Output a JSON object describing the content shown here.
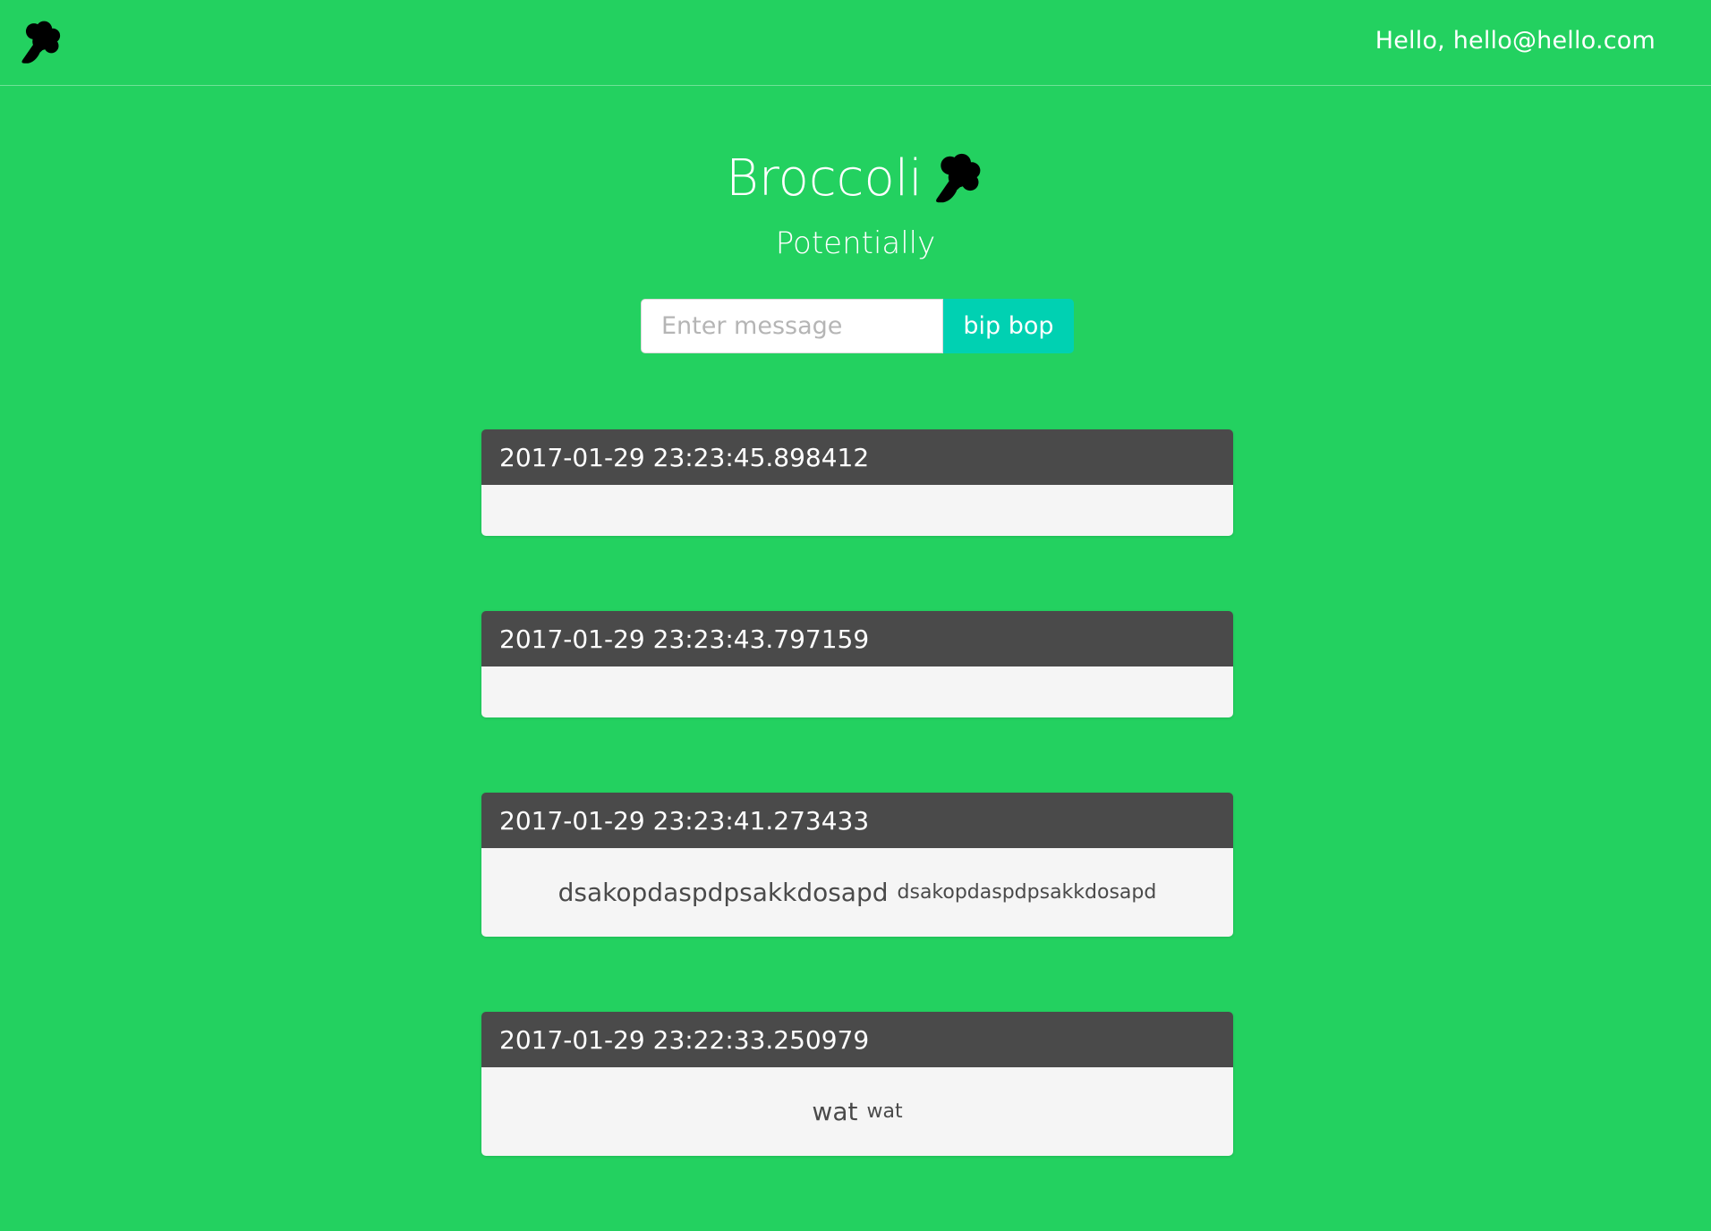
{
  "nav": {
    "logo_icon": "broccoli-icon",
    "greeting": "Hello, hello@hello.com"
  },
  "hero": {
    "title": "Broccoli",
    "title_icon": "broccoli-icon",
    "subtitle": "Potentially"
  },
  "form": {
    "placeholder": "Enter message",
    "value": "",
    "submit_label": "bip bop"
  },
  "messages": [
    {
      "timestamp": "2017-01-29 23:23:45.898412",
      "text": "",
      "subtext": ""
    },
    {
      "timestamp": "2017-01-29 23:23:43.797159",
      "text": "",
      "subtext": ""
    },
    {
      "timestamp": "2017-01-29 23:23:41.273433",
      "text": "dsakopdaspdpsakkdosapd",
      "subtext": "dsakopdaspdpsakkdosapd"
    },
    {
      "timestamp": "2017-01-29 23:22:33.250979",
      "text": "wat",
      "subtext": "wat"
    }
  ],
  "colors": {
    "background": "#23d160",
    "button": "#00d1b2",
    "card_header": "#4a4a4a",
    "card_body": "#f5f5f5"
  }
}
